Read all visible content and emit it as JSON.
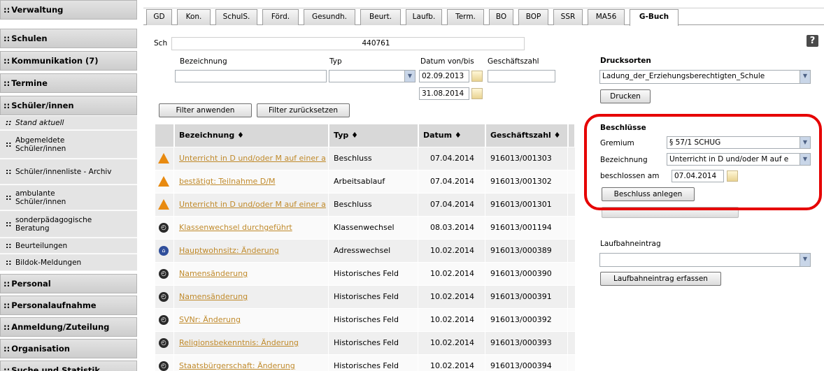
{
  "sidebar": {
    "sections": [
      {
        "label": "Verwaltung"
      },
      {
        "label": "Schulen"
      },
      {
        "label": "Kommunikation (7)"
      },
      {
        "label": "Termine"
      },
      {
        "label": "Schüler/innen"
      },
      {
        "label": "Personal"
      },
      {
        "label": "Personalaufnahme"
      },
      {
        "label": "Anmeldung/Zuteilung"
      },
      {
        "label": "Organisation"
      },
      {
        "label": "Suche und Statistik"
      }
    ],
    "sub_items": [
      {
        "label": "Stand aktuell"
      },
      {
        "label": "Abgemeldete Schüler/innen"
      },
      {
        "label": "Schüler/innenliste - Archiv"
      },
      {
        "label": "ambulante Schüler/innen"
      },
      {
        "label": "sonderpädagogische Beratung"
      },
      {
        "label": "Beurteilungen"
      },
      {
        "label": "Bildok-Meldungen"
      }
    ],
    "bullet": "::"
  },
  "tabs": [
    "GD",
    "Kon.",
    "SchulS.",
    "Förd.",
    "Gesundh.",
    "Beurt.",
    "Laufb.",
    "Term.",
    "BO",
    "BOP",
    "SSR",
    "MA56",
    "G-Buch"
  ],
  "active_tab": "G-Buch",
  "student_bar": {
    "prefix": "Sch",
    "id_fragment": "440761"
  },
  "help_label": "?",
  "filter": {
    "bezeichnung_label": "Bezeichnung",
    "typ_label": "Typ",
    "datum_label": "Datum von/bis",
    "geschaeftszahl_label": "Geschäftszahl",
    "datum_von": "02.09.2013",
    "datum_bis": "31.08.2014",
    "apply_label": "Filter anwenden",
    "reset_label": "Filter zurücksetzen"
  },
  "table": {
    "headers": [
      "Bezeichnung ♦",
      "Typ ♦",
      "Datum ♦",
      "Geschäftszahl ♦"
    ],
    "rows": [
      {
        "icon": "warning",
        "bezeichnung": "Unterricht in D und/oder M auf einer a",
        "typ": "Beschluss",
        "datum": "07.04.2014",
        "zahl": "916013/001303"
      },
      {
        "icon": "warning",
        "bezeichnung": "bestätigt: Teilnahme D/M",
        "typ": "Arbeitsablauf",
        "datum": "07.04.2014",
        "zahl": "916013/001302"
      },
      {
        "icon": "warning",
        "bezeichnung": "Unterricht in D und/oder M auf einer a",
        "typ": "Beschluss",
        "datum": "07.04.2014",
        "zahl": "916013/001301"
      },
      {
        "icon": "clock",
        "bezeichnung": "Klassenwechsel durchgeführt",
        "typ": "Klassenwechsel",
        "datum": "08.03.2014",
        "zahl": "916013/001194"
      },
      {
        "icon": "home",
        "bezeichnung": "Hauptwohnsitz: Änderung",
        "typ": "Adresswechsel",
        "datum": "10.02.2014",
        "zahl": "916013/000389"
      },
      {
        "icon": "clock",
        "bezeichnung": "Namensänderung",
        "typ": "Historisches Feld",
        "datum": "10.02.2014",
        "zahl": "916013/000390"
      },
      {
        "icon": "clock",
        "bezeichnung": "Namensänderung",
        "typ": "Historisches Feld",
        "datum": "10.02.2014",
        "zahl": "916013/000391"
      },
      {
        "icon": "clock",
        "bezeichnung": "SVNr: Änderung",
        "typ": "Historisches Feld",
        "datum": "10.02.2014",
        "zahl": "916013/000392"
      },
      {
        "icon": "clock",
        "bezeichnung": "Religionsbekenntnis: Änderung",
        "typ": "Historisches Feld",
        "datum": "10.02.2014",
        "zahl": "916013/000393"
      },
      {
        "icon": "clock",
        "bezeichnung": "Staatsbürgerschaft: Änderung",
        "typ": "Historisches Feld",
        "datum": "10.02.2014",
        "zahl": "916013/000394"
      }
    ]
  },
  "drucksorten": {
    "title": "Drucksorten",
    "selected": "Ladung_der_Erziehungsberechtigten_Schule",
    "print_label": "Drucken"
  },
  "beschluesse": {
    "title": "Beschlüsse",
    "gremium_label": "Gremium",
    "gremium_value": "§ 57/1 SCHUG",
    "bezeichnung_label": "Bezeichnung",
    "bezeichnung_value": "Unterricht in D und/oder M auf e",
    "beschlossen_label": "beschlossen am",
    "beschlossen_value": "07.04.2014",
    "create_label": "Beschluss anlegen"
  },
  "laufbahn": {
    "title": "Laufbahneintrag",
    "capture_label": "Laufbahneintrag erfassen"
  },
  "colors": {
    "link": "#c08a2b",
    "highlight": "#e60000",
    "warning": "#e88a10"
  }
}
